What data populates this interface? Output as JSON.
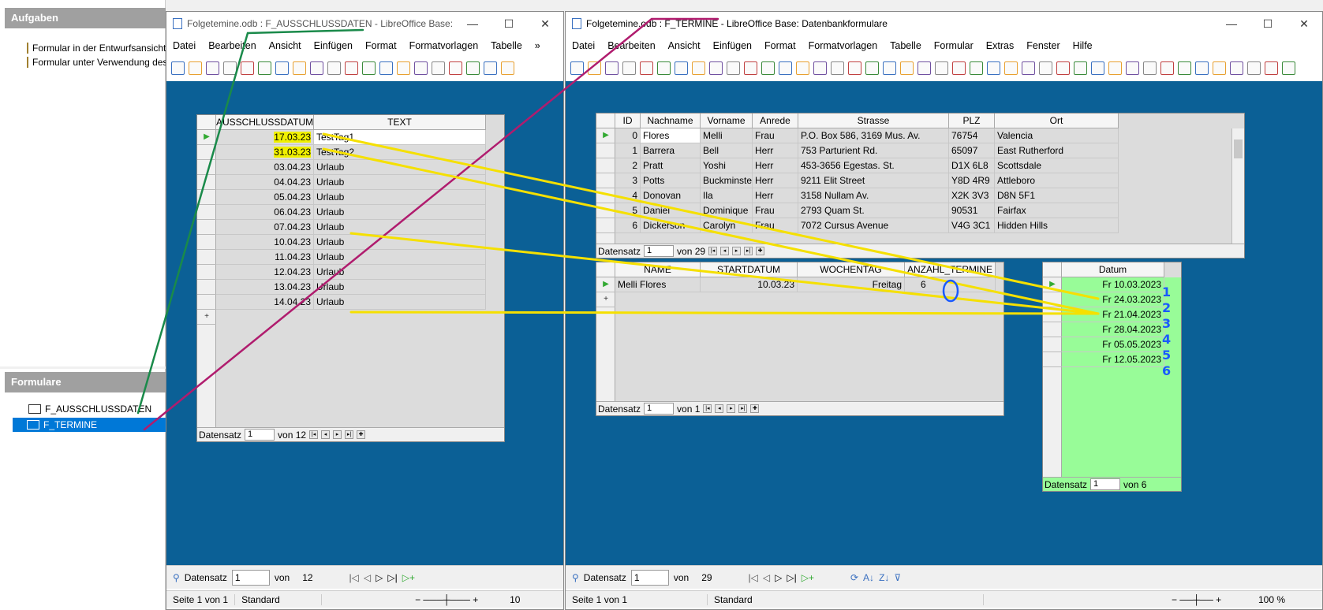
{
  "left_panel": {
    "tasks_title": "Aufgaben",
    "tasks": [
      "Formular in der Entwurfsansicht erstellen...",
      "Formular unter Verwendung des Assistenten erstellen..."
    ],
    "forms_title": "Formulare",
    "forms": [
      "F_AUSSCHLUSSDATEN",
      "F_TERMINE"
    ]
  },
  "win1": {
    "title": "Folgetemine.odb : F_AUSSCHLUSSDATEN - LibreOffice Base: D...",
    "menu": [
      "Datei",
      "Bearbeiten",
      "Ansicht",
      "Einfügen",
      "Format",
      "Formatvorlagen",
      "Tabelle",
      "»"
    ],
    "grid": {
      "headers": [
        "AUSSCHLUSSDATUM",
        "TEXT"
      ],
      "rows": [
        [
          "17.03.23",
          "TestTag1"
        ],
        [
          "31.03.23",
          "TestTag2"
        ],
        [
          "03.04.23",
          "Urlaub"
        ],
        [
          "04.04.23",
          "Urlaub"
        ],
        [
          "05.04.23",
          "Urlaub"
        ],
        [
          "06.04.23",
          "Urlaub"
        ],
        [
          "07.04.23",
          "Urlaub"
        ],
        [
          "10.04.23",
          "Urlaub"
        ],
        [
          "11.04.23",
          "Urlaub"
        ],
        [
          "12.04.23",
          "Urlaub"
        ],
        [
          "13.04.23",
          "Urlaub"
        ],
        [
          "14.04.23",
          "Urlaub"
        ]
      ],
      "nav_label": "Datensatz",
      "nav_value": "1",
      "nav_of": "von 12"
    },
    "nav_label": "Datensatz",
    "nav_value": "1",
    "nav_of": "von",
    "nav_count": "12",
    "status": [
      "Seite 1 von 1",
      "Standard"
    ],
    "status_zoom": "10"
  },
  "win2": {
    "title": "Folgetemine.odb : F_TERMINE - LibreOffice Base: Datenbankformulare",
    "menu": [
      "Datei",
      "Bearbeiten",
      "Ansicht",
      "Einfügen",
      "Format",
      "Formatvorlagen",
      "Tabelle",
      "Formular",
      "Extras",
      "Fenster",
      "Hilfe"
    ],
    "grid1": {
      "headers": [
        "ID",
        "Nachname",
        "Vorname",
        "Anrede",
        "Strasse",
        "PLZ",
        "Ort"
      ],
      "rows": [
        [
          "0",
          "Flores",
          "Melli",
          "Frau",
          "P.O. Box 586, 3169 Mus. Av.",
          "76754",
          "Valencia"
        ],
        [
          "1",
          "Barrera",
          "Bell",
          "Herr",
          "753 Parturient Rd.",
          "65097",
          "East Rutherford"
        ],
        [
          "2",
          "Pratt",
          "Yoshi",
          "Herr",
          "453-3656 Egestas. St.",
          "D1X 6L8",
          "Scottsdale"
        ],
        [
          "3",
          "Potts",
          "Buckminster",
          "Herr",
          "9211 Elit Street",
          "Y8D 4R9",
          "Attleboro"
        ],
        [
          "4",
          "Donovan",
          "Ila",
          "Herr",
          "3158 Nullam Av.",
          "X2K 3V3",
          "D8N 5F1"
        ],
        [
          "5",
          "Daniel",
          "Dominique",
          "Frau",
          "2793 Quam St.",
          "90531",
          "Fairfax"
        ],
        [
          "6",
          "Dickerson",
          "Carolyn",
          "Frau",
          "7072 Cursus Avenue",
          "V4G 3C1",
          "Hidden Hills"
        ]
      ],
      "nav_label": "Datensatz",
      "nav_value": "1",
      "nav_of": "von 29"
    },
    "grid2": {
      "headers": [
        "NAME",
        "STARTDATUM",
        "WOCHENTAG",
        "ANZAHL_TERMINE"
      ],
      "row": [
        "Melli Flores",
        "10.03.23",
        "Freitag",
        "6"
      ],
      "nav_label": "Datensatz",
      "nav_value": "1",
      "nav_of": "von 1"
    },
    "grid3": {
      "header": "Datum",
      "rows": [
        "Fr 10.03.2023",
        "Fr 24.03.2023",
        "Fr 21.04.2023",
        "Fr 28.04.2023",
        "Fr 05.05.2023",
        "Fr 12.05.2023"
      ],
      "nav_label": "Datensatz",
      "nav_value": "1",
      "nav_of": "von 6",
      "annotations": [
        "1",
        "2",
        "3",
        "4",
        "5",
        "6"
      ]
    },
    "nav_label": "Datensatz",
    "nav_value": "1",
    "nav_of": "von",
    "nav_count": "29",
    "status": [
      "Seite 1 von 1",
      "Standard"
    ],
    "status_zoom": "100 %"
  },
  "colors": {
    "canvas": "#0b6096",
    "highlight": "#f0f000",
    "green": "#98fc98",
    "selection": "#0078d7",
    "arrow_yellow": "#f5e000",
    "line_green": "#1a8a4a",
    "line_magenta": "#b01c6e",
    "ink_blue": "#1a5aff"
  }
}
